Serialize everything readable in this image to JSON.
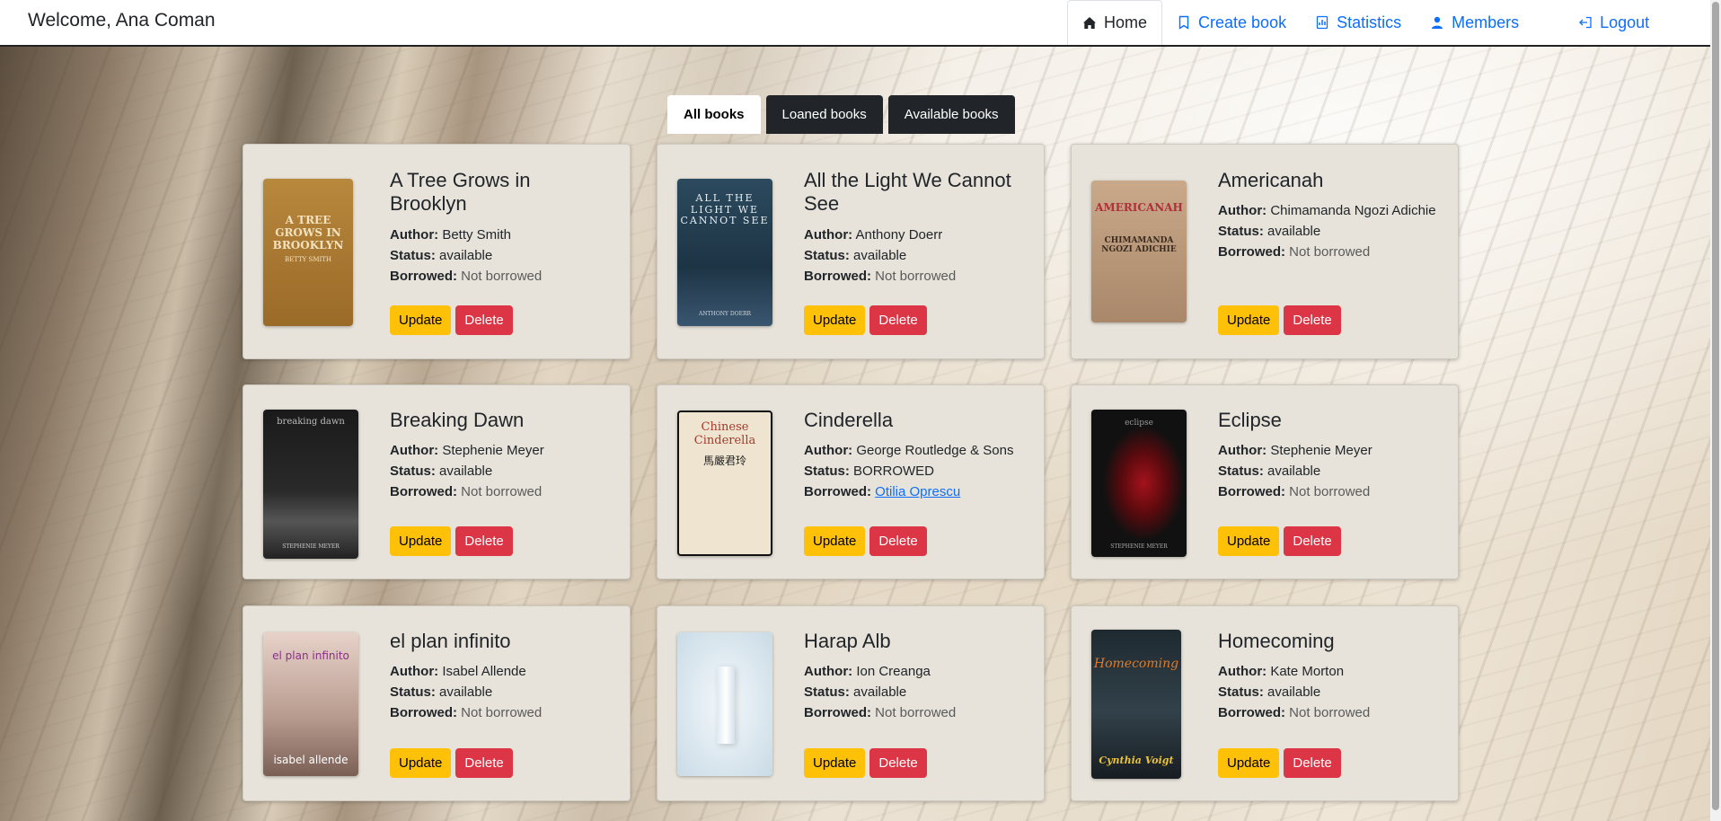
{
  "header": {
    "welcome": "Welcome, Ana Coman",
    "nav": [
      {
        "label": "Home",
        "icon": "home-icon",
        "active": true
      },
      {
        "label": "Create book",
        "icon": "bookmark-icon"
      },
      {
        "label": "Statistics",
        "icon": "statistics-icon"
      },
      {
        "label": "Members",
        "icon": "user-icon"
      },
      {
        "label": "Logout",
        "icon": "logout-icon"
      }
    ]
  },
  "tabs": [
    "All books",
    "Loaned books",
    "Available books"
  ],
  "labels": {
    "author": "Author:",
    "status": "Status:",
    "borrowed": "Borrowed:",
    "update": "Update",
    "delete": "Delete"
  },
  "books": [
    {
      "title": "A Tree Grows in Brooklyn",
      "author": "Betty Smith",
      "status": "available",
      "borrowed": "Not borrowed",
      "cover_text": "A TREE GROWS IN BROOKLYN",
      "cover_sub": "BETTY SMITH"
    },
    {
      "title": "All the Light We Cannot See",
      "author": "Anthony Doerr",
      "status": "available",
      "borrowed": "Not borrowed",
      "cover_text": "ALL THE LIGHT WE CANNOT SEE",
      "cover_sub": "ANTHONY DOERR"
    },
    {
      "title": "Americanah",
      "author": "Chimamanda Ngozi Adichie",
      "status": "available",
      "borrowed": "Not borrowed",
      "cover_text": "AMERICANAH",
      "cover_sub": "CHIMAMANDA NGOZI ADICHIE"
    },
    {
      "title": "Breaking Dawn",
      "author": "Stephenie Meyer",
      "status": "available",
      "borrowed": "Not borrowed",
      "cover_text": "breaking dawn",
      "cover_sub": "STEPHENIE MEYER"
    },
    {
      "title": "Cinderella",
      "author": "George Routledge & Sons",
      "status": "BORROWED",
      "borrowed": "Otilia Oprescu",
      "borrowed_link": true,
      "cover_text": "Chinese Cinderella",
      "cover_sub": "馬嚴君玲"
    },
    {
      "title": "Eclipse",
      "author": "Stephenie Meyer",
      "status": "available",
      "borrowed": "Not borrowed",
      "cover_text": "eclipse",
      "cover_sub": "STEPHENIE MEYER"
    },
    {
      "title": "el plan infinito",
      "author": "Isabel Allende",
      "status": "available",
      "borrowed": "Not borrowed",
      "cover_text": "el plan infinito",
      "cover_sub": "isabel allende"
    },
    {
      "title": "Harap Alb",
      "author": "Ion Creanga",
      "status": "available",
      "borrowed": "Not borrowed",
      "cover_text": "",
      "cover_sub": ""
    },
    {
      "title": "Homecoming",
      "author": "Kate Morton",
      "status": "available",
      "borrowed": "Not borrowed",
      "cover_text": "Homecoming",
      "cover_sub": "Cynthia Voigt"
    }
  ],
  "colors": {
    "update": "#ffc107",
    "delete": "#dc3545",
    "link": "#0d6efd",
    "card": "#e7e3da",
    "tab_dark": "#212529"
  }
}
